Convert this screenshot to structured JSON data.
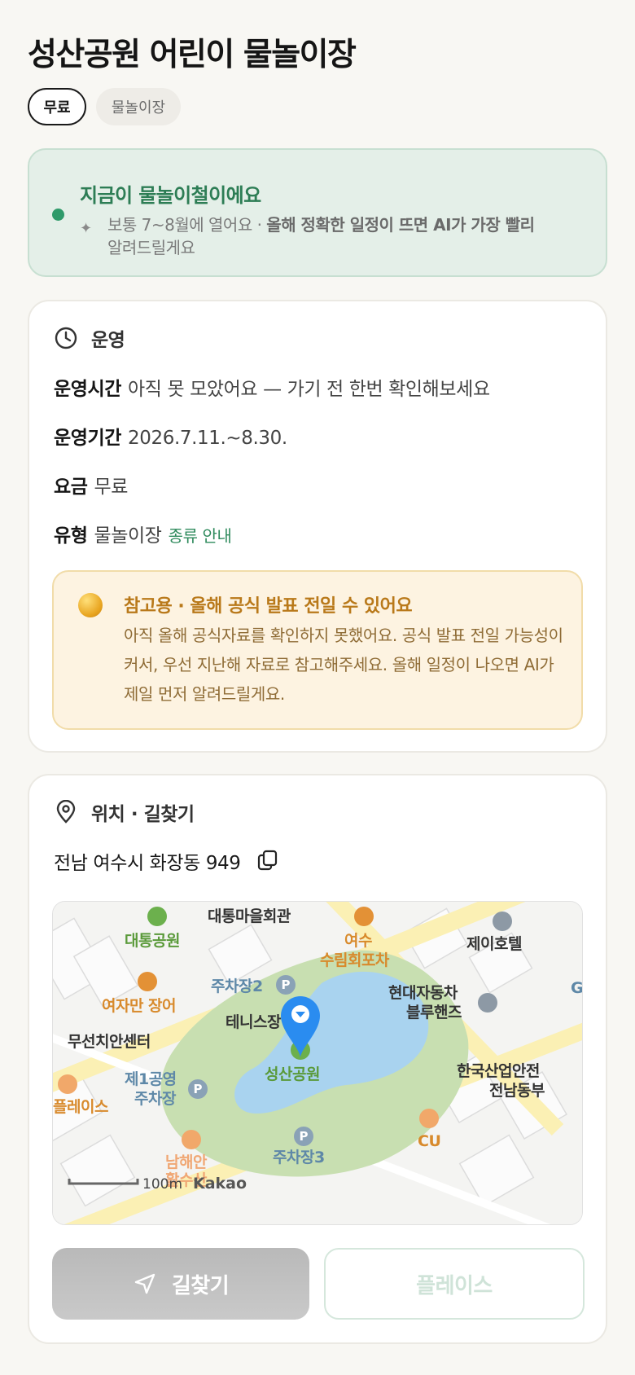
{
  "page": {
    "title": "성산공원 어린이 물놀이장",
    "chips": {
      "free": "무료",
      "type": "물놀이장"
    }
  },
  "season": {
    "title": "지금이 물놀이철이에요",
    "desc_normal": "보통 7~8월에 열어요 · ",
    "desc_bold": "올해 정확한 일정이 뜨면 AI가 가장 빨리",
    "desc_tail": "알려드릴게요",
    "icon": "sparkle-icon"
  },
  "operation": {
    "heading": "운영",
    "icon": "clock-icon",
    "rows": [
      {
        "key": "운영시간",
        "value": "아직 못 모았어요 — 가기 전 한번 확인해보세요"
      },
      {
        "key": "운영기간",
        "value": "2026.7.11.~8.30."
      },
      {
        "key": "요금",
        "value": "무료"
      },
      {
        "key": "유형",
        "value": "물놀이장"
      }
    ],
    "type_link": "종류 안내",
    "notice": {
      "title": "참고용 · 올해 공식 발표 전일 수 있어요",
      "body": "아직 올해 공식자료를 확인하지 못했어요. 공식 발표 전일 가능성이 커서, 우선 지난해 자료로 참고해주세요. 올해 일정이 나오면 AI가 제일 먼저 알려드릴게요."
    }
  },
  "location": {
    "heading": "위치 · 길찾기",
    "icon": "location-pin-icon",
    "address": "전남 여수시 화장동 949",
    "copy_icon": "copy-icon",
    "map": {
      "labels": {
        "community_hall": "대통마을회관",
        "daetong_park": "대통공원",
        "restaurant": "여수\n수림회포차",
        "hotel": "제이호텔",
        "parking2": "주차장2",
        "eel": "여자만 장어",
        "tennis": "테니스장",
        "hyundai": "현대자동차\n블루핸즈",
        "center": "무선치안센터",
        "park": "성산공원",
        "industry": "한국산업안전\n전남동부",
        "parking1": "제1공영\n주차장",
        "place": "플레이스",
        "cu": "CU",
        "namhae": "남해안\n활수산",
        "parking3": "주차장3",
        "scale": "100m",
        "brand": "Kakao",
        "edge": "G"
      },
      "parking_symbol": "P"
    },
    "buttons": {
      "directions": "길찾기",
      "place": "플레이스"
    },
    "colors": {
      "accent_green": "#2d7d55",
      "park_green": "#c8dfb1",
      "water": "#a9d3ef",
      "pin": "#2a8cf0"
    }
  }
}
